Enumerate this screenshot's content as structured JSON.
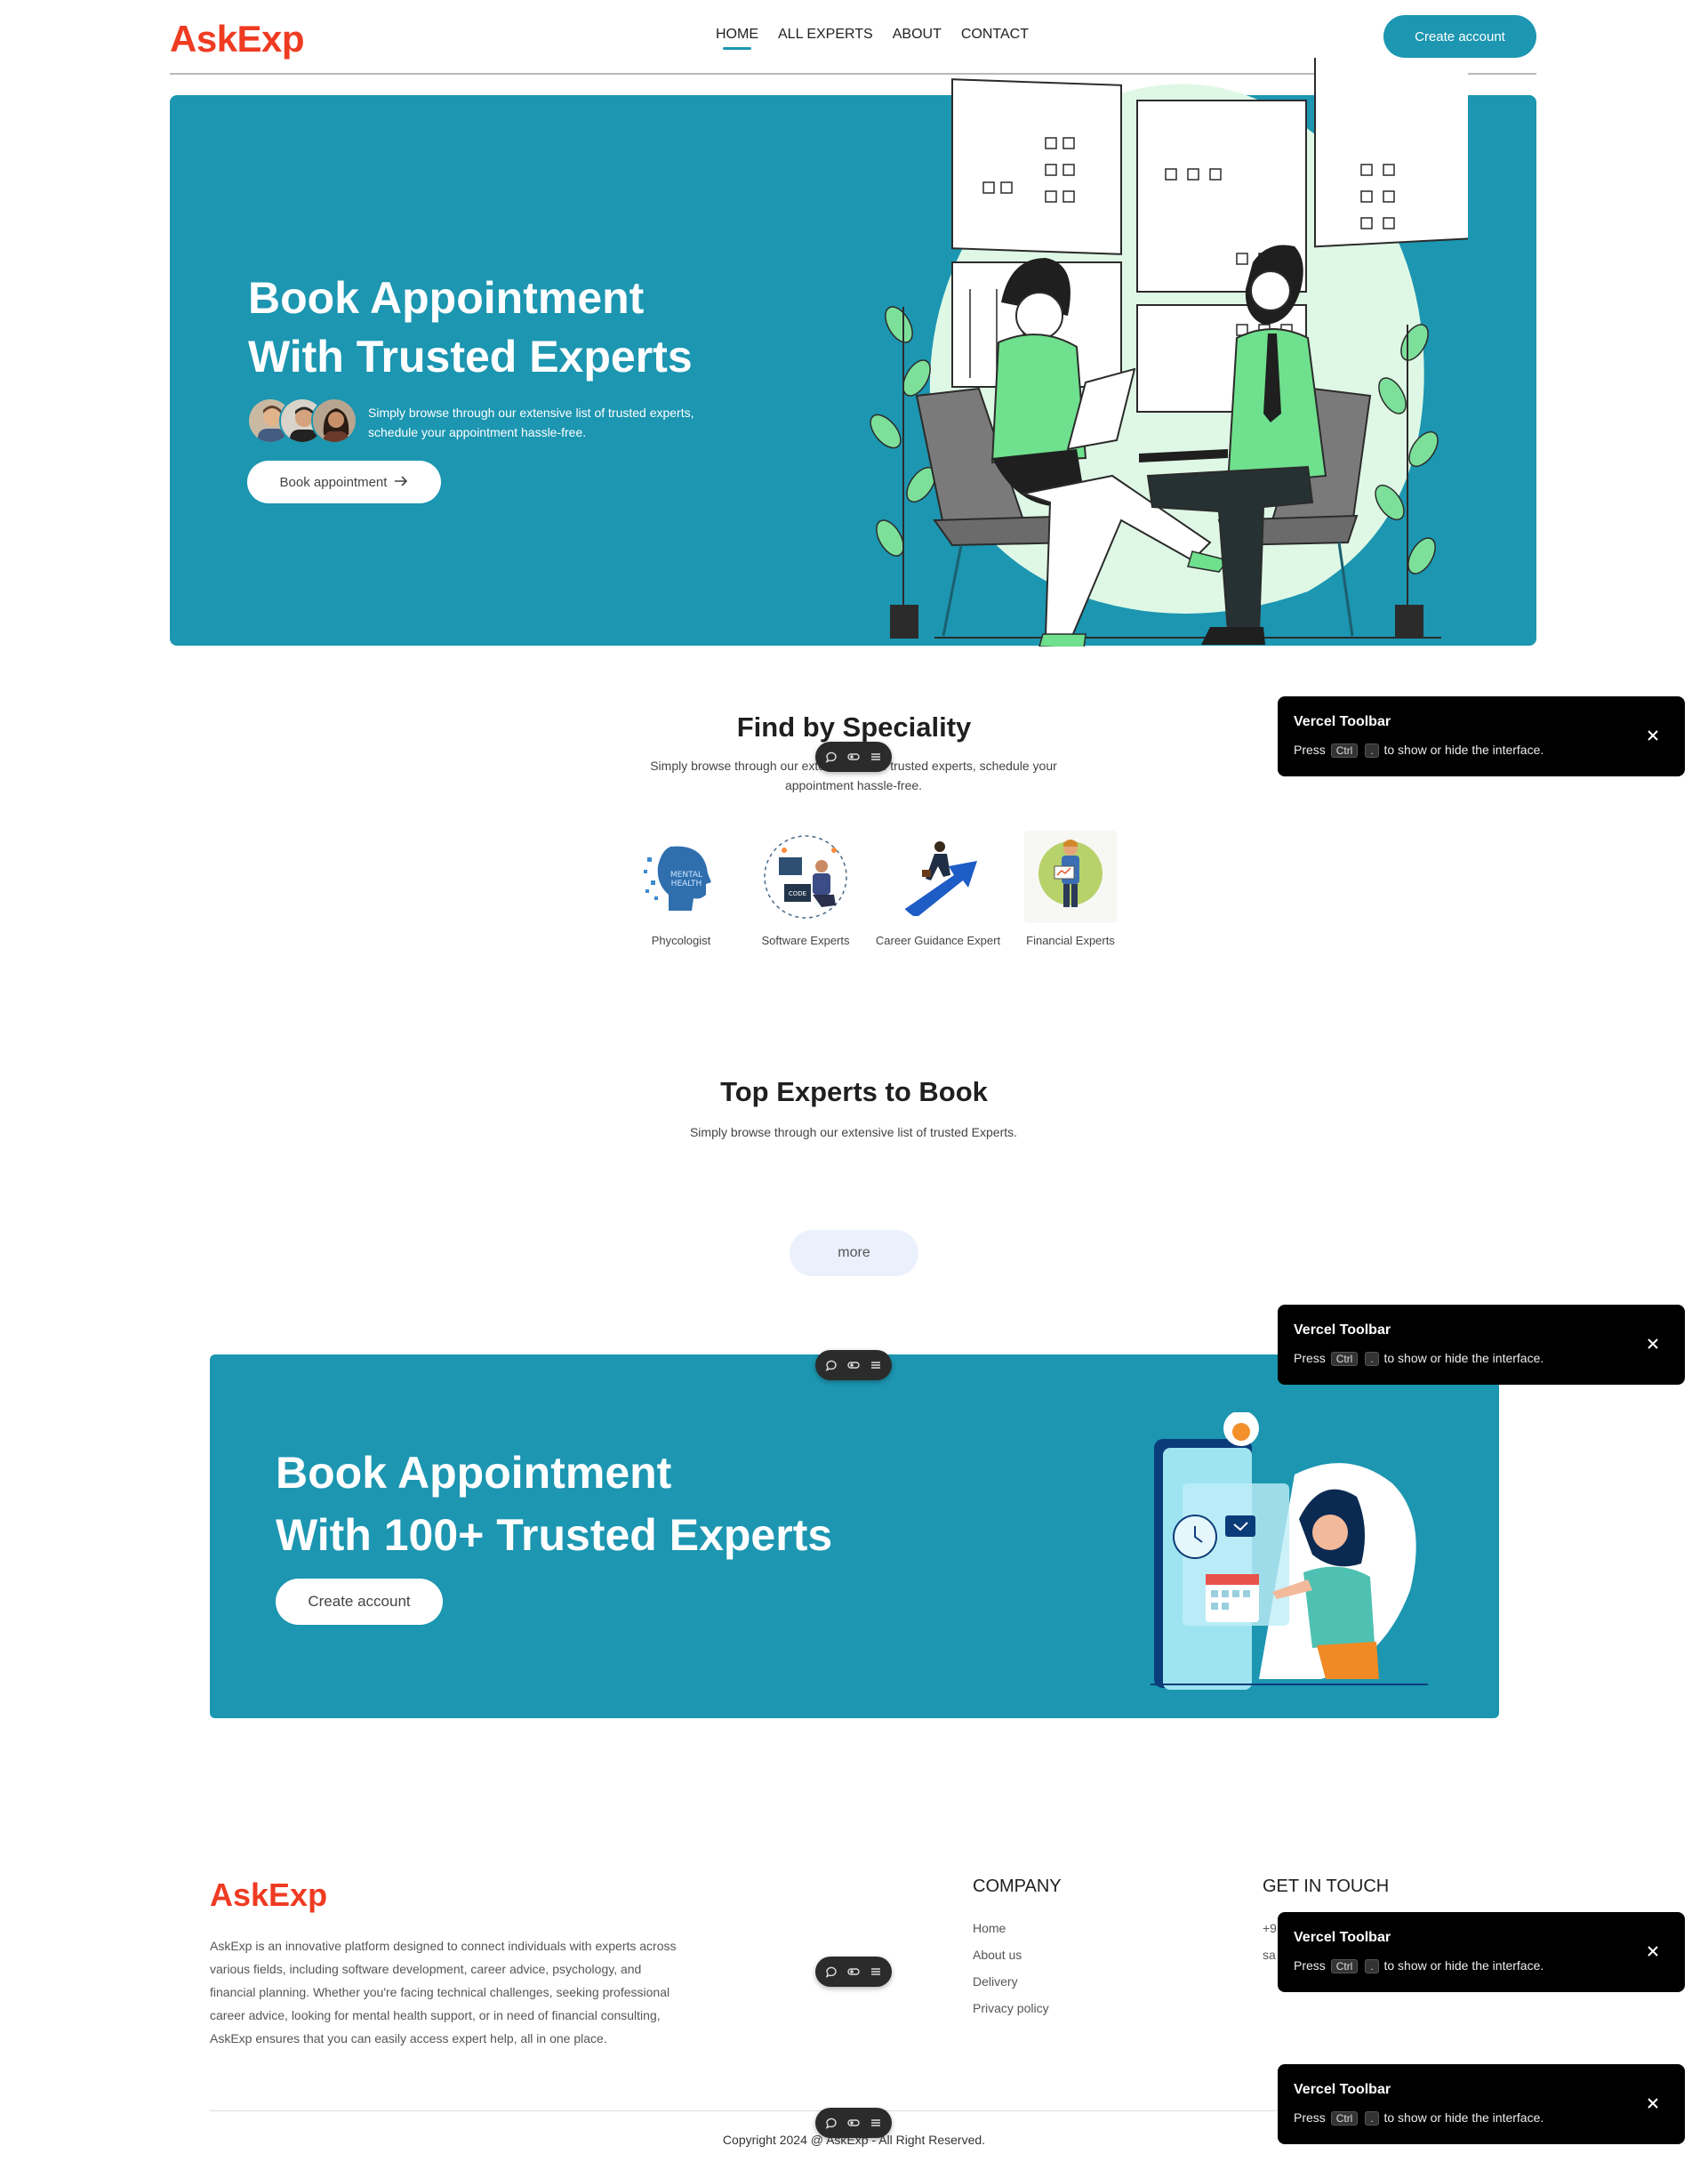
{
  "nav": {
    "logo": "AskExp",
    "links": [
      "HOME",
      "ALL EXPERTS",
      "ABOUT",
      "CONTACT"
    ],
    "active_index": 0,
    "create_account": "Create account"
  },
  "hero": {
    "title_line1": "Book Appointment",
    "title_line2": "With Trusted Experts",
    "description": "Simply browse through our extensive list of trusted experts, schedule your appointment hassle-free.",
    "button": "Book appointment",
    "button_icon": "arrow-right-icon",
    "illustration": "two-people-meeting-illustration"
  },
  "speciality": {
    "title": "Find by Speciality",
    "subtitle": "Simply browse through our extensive list of trusted experts, schedule your appointment hassle-free.",
    "items": [
      {
        "label": "Phycologist",
        "icon": "mental-health-head"
      },
      {
        "label": "Software Experts",
        "icon": "coder-at-desk"
      },
      {
        "label": "Career Guidance Expert",
        "icon": "climbing-arrow"
      },
      {
        "label": "Financial Experts",
        "icon": "presenter-with-chart"
      }
    ]
  },
  "top_experts": {
    "title": "Top Experts to Book",
    "subtitle": "Simply browse through our extensive list of trusted Experts.",
    "more": "more"
  },
  "banner": {
    "title_line1": "Book Appointment",
    "title_line2": "With 100+ Trusted Experts",
    "button": "Create account",
    "illustration": "woman-booking-on-phone-illustration"
  },
  "footer": {
    "logo": "AskExp",
    "description": "AskExp is an innovative platform designed to connect individuals with experts across various fields, including software development, career advice, psychology, and financial planning. Whether you're facing technical challenges, seeking professional career advice, looking for mental health support, or in need of financial consulting, AskExp ensures that you can easily access expert help, all in one place.",
    "company_title": "COMPANY",
    "company_links": [
      "Home",
      "About us",
      "Delivery",
      "Privacy policy"
    ],
    "contact_title": "GET IN TOUCH",
    "contact_lines": [
      "+9",
      "sa"
    ],
    "copyright": "Copyright 2024 @ AskExp - All Right Reserved."
  },
  "toasts": [
    {
      "title": "Vercel Toolbar",
      "press": "Press",
      "key1": "Ctrl",
      "key2": ".",
      "rest": "to show or hide the interface."
    },
    {
      "title": "Vercel Toolbar",
      "press": "Press",
      "key1": "Ctrl",
      "key2": ".",
      "rest": "to show or hide the interface."
    },
    {
      "title": "Vercel Toolbar",
      "press": "Press",
      "key1": "Ctrl",
      "key2": ".",
      "rest": "to show or hide the interface."
    },
    {
      "title": "Vercel Toolbar",
      "press": "Press",
      "key1": "Ctrl",
      "key2": ".",
      "rest": "to show or hide the interface."
    }
  ],
  "colors": {
    "brand": "#ef3b22",
    "accent": "#1c96b1",
    "more_bg": "#eaf0fc"
  }
}
